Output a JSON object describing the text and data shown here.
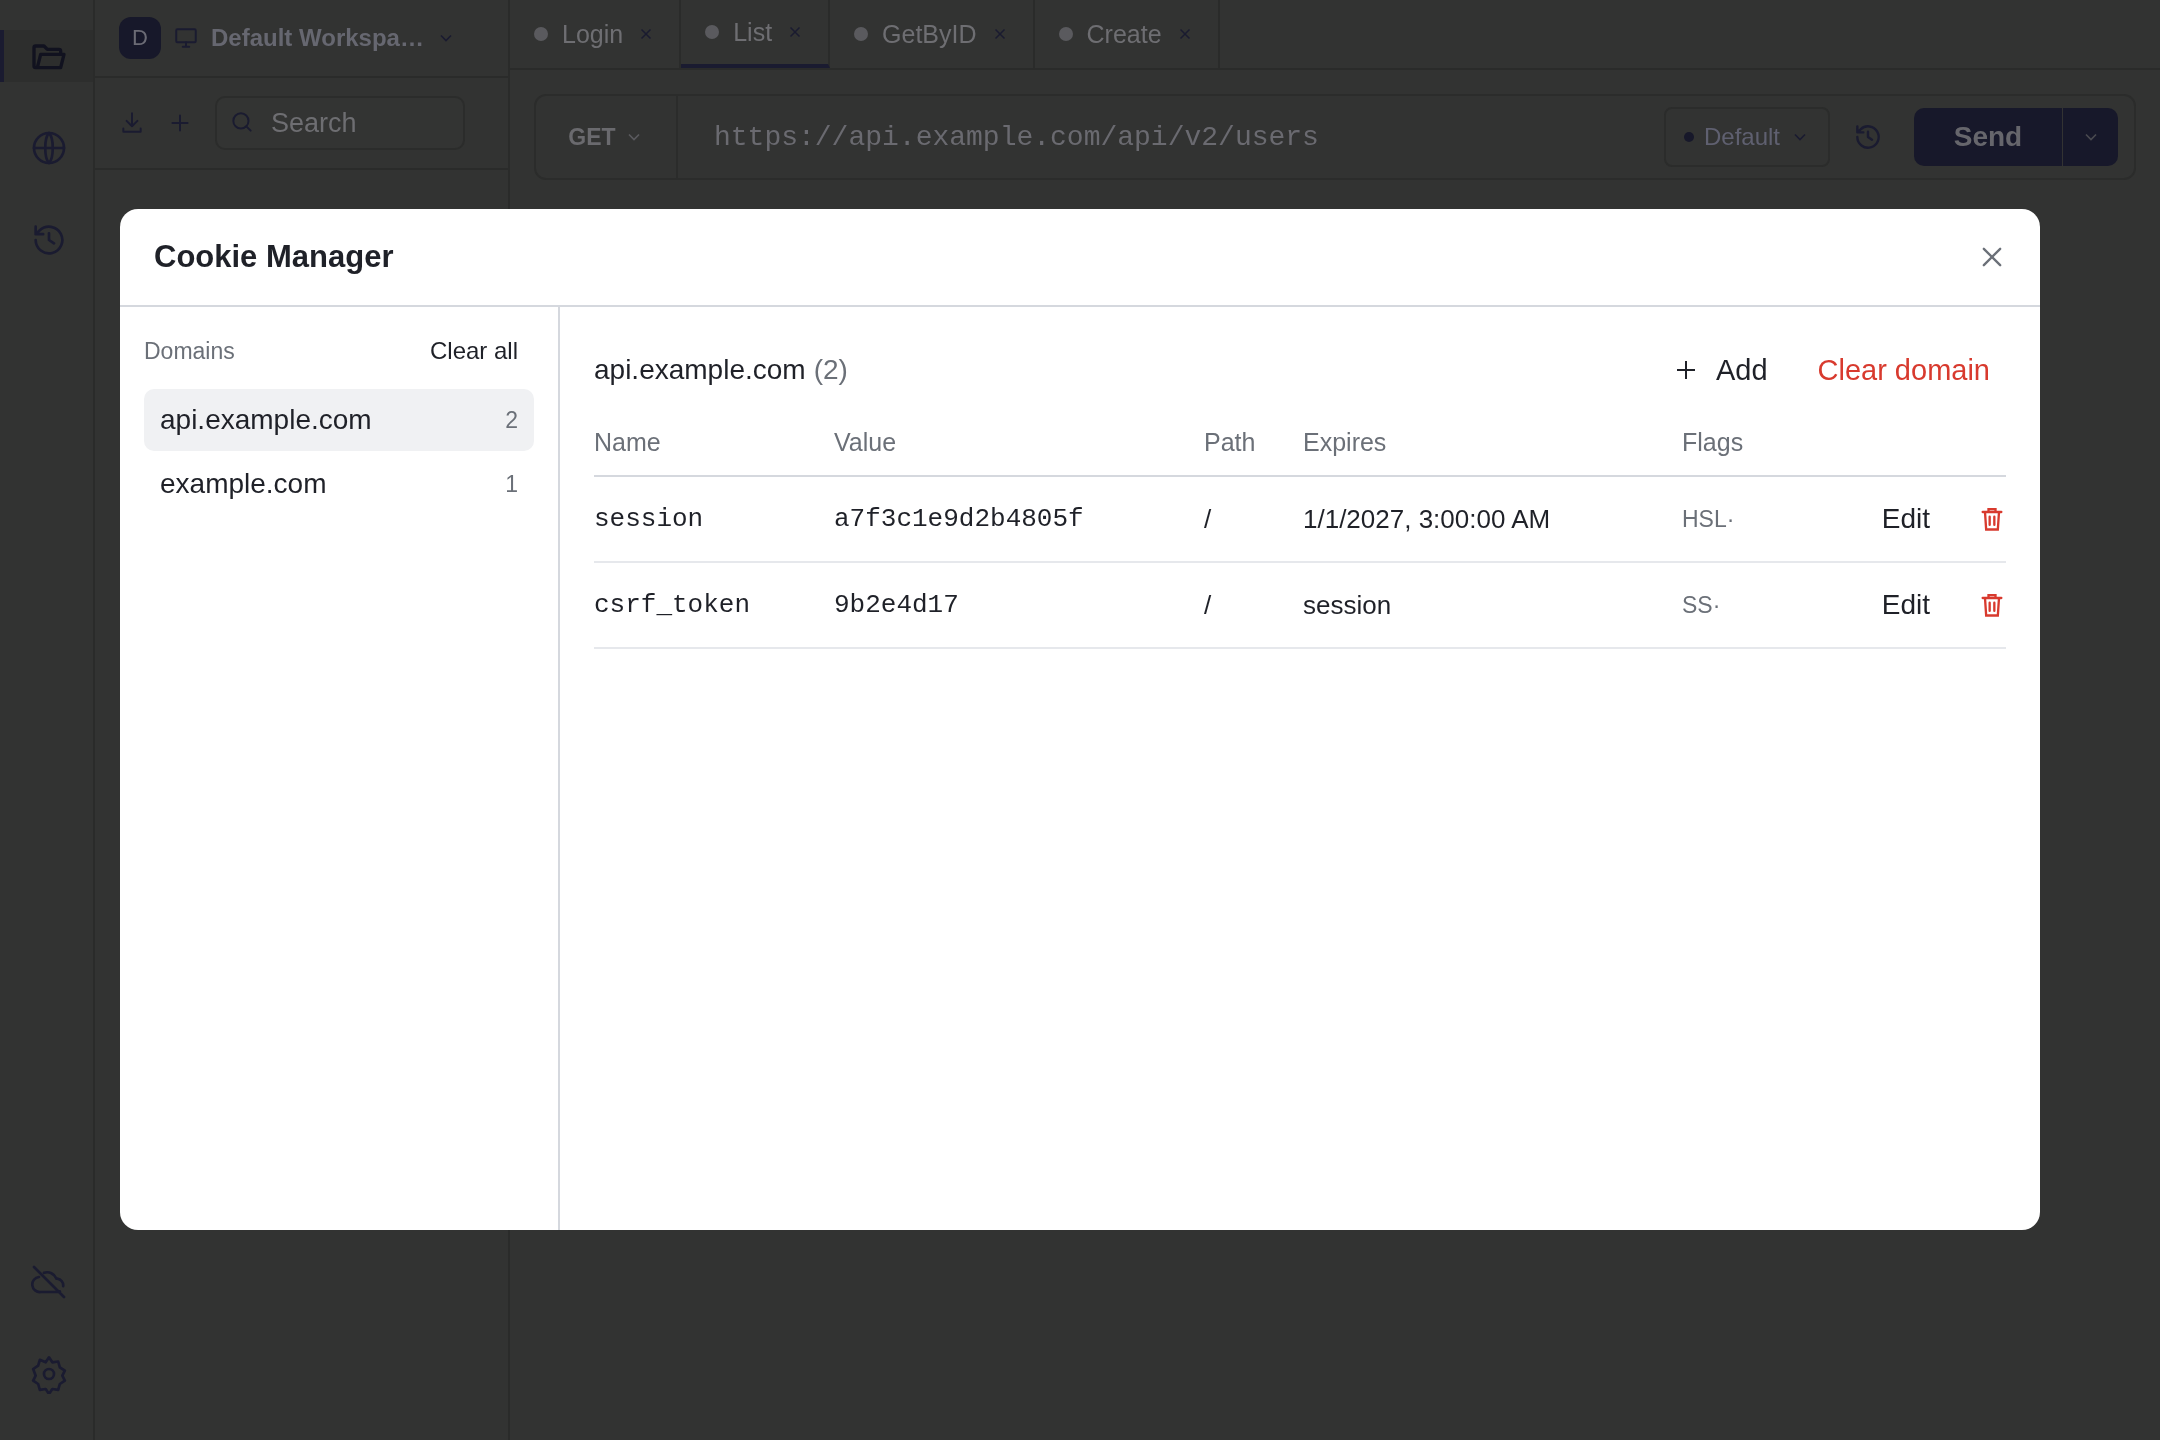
{
  "activity_bar": {
    "items": [
      {
        "selected": true
      },
      {
        "selected": false
      },
      {
        "selected": false
      }
    ]
  },
  "workspace": {
    "avatar": "D",
    "name": "Default Workspa…"
  },
  "sidebar": {
    "search": {
      "placeholder": "Search"
    }
  },
  "tabs": [
    {
      "label": "Login",
      "selected": false
    },
    {
      "label": "List",
      "selected": true
    },
    {
      "label": "GetByID",
      "selected": false
    },
    {
      "label": "Create",
      "selected": false
    }
  ],
  "request": {
    "method": "GET",
    "url": "https://api.example.com/api/v2/users",
    "environment": "Default",
    "send": "Send"
  },
  "modal": {
    "title": "Cookie Manager",
    "domains_label": "Domains",
    "clear_all": "Clear all",
    "domains": [
      {
        "name": "api.example.com",
        "count": "2",
        "selected": true
      },
      {
        "name": "example.com",
        "count": "1",
        "selected": false
      }
    ],
    "detail": {
      "domain": "api.example.com",
      "count": "(2)",
      "add": "Add",
      "clear_domain": "Clear domain",
      "columns": [
        "Name",
        "Value",
        "Path",
        "Expires",
        "Flags"
      ],
      "rows": [
        {
          "name": "session",
          "value": "a7f3c1e9d2b4805f",
          "path": "/",
          "expires": "1/1/2027, 3:00:00 AM",
          "flags": "HSL·",
          "edit": "Edit"
        },
        {
          "name": "csrf_token",
          "value": "9b2e4d17",
          "path": "/",
          "expires": "session",
          "flags": "SS·",
          "edit": "Edit"
        }
      ]
    }
  }
}
